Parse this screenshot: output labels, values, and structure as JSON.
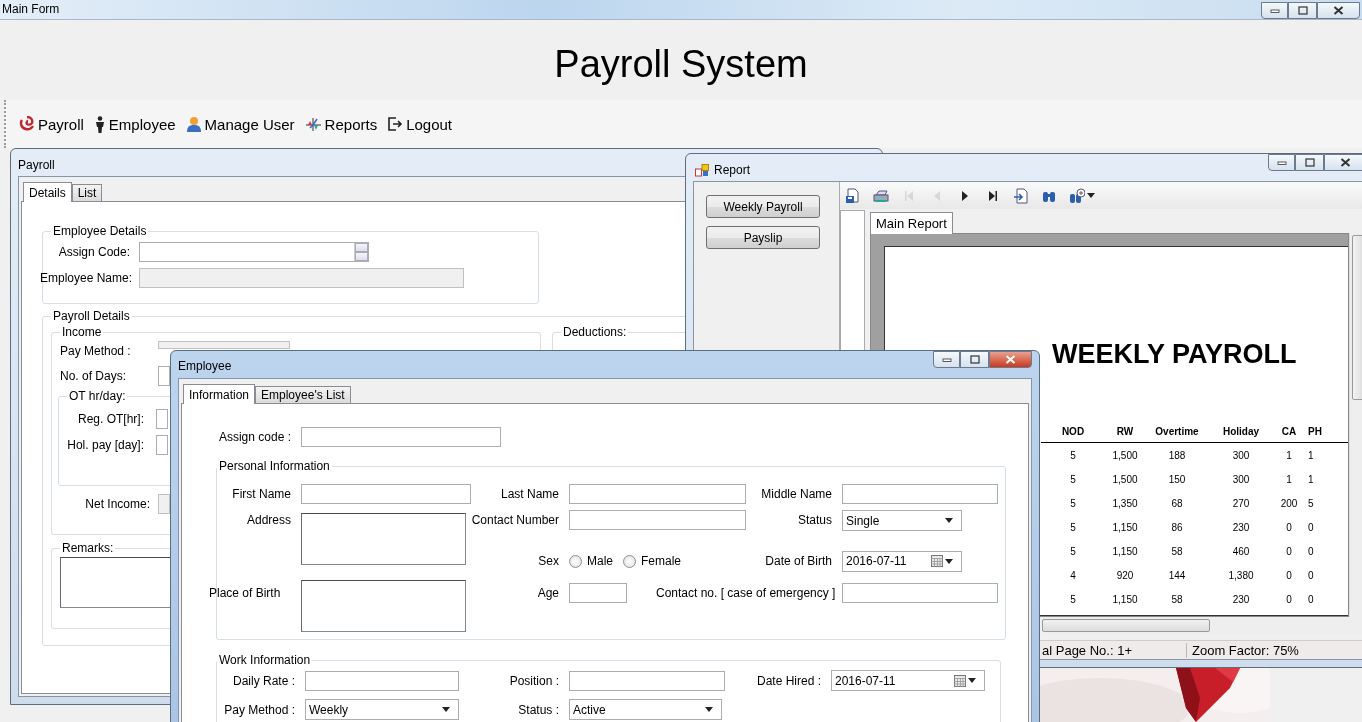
{
  "main_window": {
    "title": "Main Form"
  },
  "header": {
    "title": "Payroll System"
  },
  "toolbar": [
    {
      "label": "Payroll"
    },
    {
      "label": "Employee"
    },
    {
      "label": "Manage User"
    },
    {
      "label": "Reports"
    },
    {
      "label": "Logout"
    }
  ],
  "payroll_window": {
    "title": "Payroll",
    "tabs": [
      {
        "label": "Details",
        "selected": true
      },
      {
        "label": "List",
        "selected": false
      }
    ],
    "employee_details": {
      "title": "Employee Details",
      "fields": [
        {
          "label": "Assign Code:",
          "kind": "spin",
          "disabled": false
        },
        {
          "label": "Employee Name:",
          "kind": "text",
          "disabled": true
        }
      ]
    },
    "payroll_details": {
      "title": "Payroll Details",
      "income": {
        "title": "Income",
        "fields": [
          {
            "label": "Pay Method  :",
            "disabled": true
          },
          {
            "label": "No. of Days:",
            "disabled": false
          }
        ],
        "overtime": {
          "title": "OT hr/day:",
          "fields": [
            {
              "label": "Reg. OT[hr]:",
              "disabled": false
            },
            {
              "label": "Hol. pay [day]:",
              "disabled": false
            }
          ]
        },
        "net_income": {
          "label": "Net Income:",
          "disabled": true
        }
      },
      "deductions": {
        "title": "Deductions:"
      },
      "remarks": {
        "title": "Remarks:"
      }
    }
  },
  "report_window": {
    "title": "Report",
    "buttons": [
      "Weekly Payroll",
      "Payslip"
    ],
    "tools": [
      {
        "disabled": false
      },
      {
        "disabled": false
      },
      {
        "disabled": true
      },
      {
        "disabled": true
      },
      {
        "disabled": false
      },
      {
        "disabled": false
      },
      {
        "disabled": false
      },
      {
        "disabled": false
      },
      {
        "disabled": false
      }
    ],
    "tabs": [
      {
        "label": "Main Report",
        "selected": true
      }
    ],
    "report": {
      "title": "WEEKLY PAYROLL",
      "columns": [
        "NOD",
        "RW",
        "Overtime",
        "Holiday",
        "CA",
        "PH"
      ],
      "rows": [
        [
          "5",
          "1,500",
          "188",
          "300",
          "1",
          "1"
        ],
        [
          "5",
          "1,500",
          "150",
          "300",
          "1",
          "1"
        ],
        [
          "5",
          "1,350",
          "68",
          "270",
          "200",
          "5"
        ],
        [
          "5",
          "1,150",
          "86",
          "230",
          "0",
          "0"
        ],
        [
          "5",
          "1,150",
          "58",
          "460",
          "0",
          "0"
        ],
        [
          "4",
          "920",
          "144",
          "1,380",
          "0",
          "0"
        ],
        [
          "5",
          "1,150",
          "58",
          "230",
          "0",
          "0"
        ]
      ]
    },
    "status_bar": [
      "al Page No.: 1+",
      "Zoom Factor: 75%"
    ]
  },
  "employee_window": {
    "title": "Employee",
    "tabs": [
      {
        "label": "Information",
        "selected": true
      },
      {
        "label": "Employee's List",
        "selected": false
      }
    ],
    "assign_code": {
      "label": "Assign code :"
    },
    "personal": {
      "title": "Personal Information",
      "first_name": {
        "label": "First Name"
      },
      "last_name": {
        "label": "Last Name"
      },
      "middle_name": {
        "label": "Middle Name"
      },
      "address": {
        "label": "Address"
      },
      "contact_number": {
        "label": "Contact Number"
      },
      "status": {
        "label": "Status",
        "value": "Single"
      },
      "sex": {
        "label": "Sex",
        "options": [
          {
            "label": "Male",
            "selected": false
          },
          {
            "label": "Female",
            "selected": false
          }
        ]
      },
      "date_of_birth": {
        "label": "Date of Birth",
        "value": "2016-07-11"
      },
      "place_of_birth": {
        "label": "Place of Birth"
      },
      "age": {
        "label": "Age"
      },
      "emergency_contact": {
        "label": "Contact no. [ case of emergency ]"
      }
    },
    "work": {
      "title": "Work Information",
      "daily_rate": {
        "label": "Daily Rate :"
      },
      "position": {
        "label": "Position :"
      },
      "date_hired": {
        "label": "Date Hired :",
        "value": "2016-07-11"
      },
      "pay_method": {
        "label": "Pay Method :",
        "value": "Weekly"
      },
      "status": {
        "label": "Status :",
        "value": "Active"
      }
    }
  }
}
